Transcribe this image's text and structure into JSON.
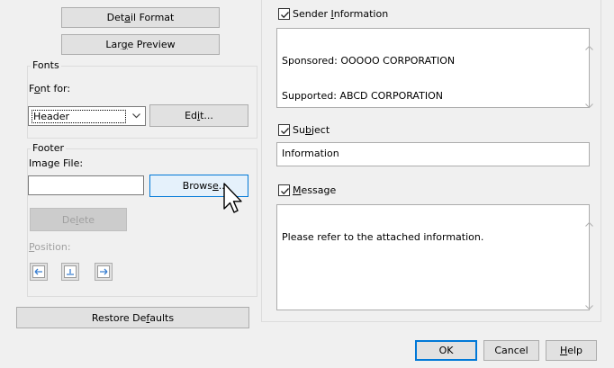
{
  "left": {
    "detail_format": "Detail Format",
    "large_preview": "Large Preview",
    "fonts": {
      "group_label": "Fonts",
      "font_for_label": "Font for:",
      "font_for_value": "Header",
      "edit_button": "Edit..."
    },
    "footer": {
      "group_label": "Footer",
      "image_file_label": "Image File:",
      "image_file_value": "",
      "browse_button": "Browse...",
      "delete_button": "Delete",
      "position_label": "Position:"
    },
    "restore_defaults": "Restore Defaults"
  },
  "right": {
    "sender": {
      "checked": true,
      "label": "Sender Information",
      "lines": [
        "Sponsored: OOOOO CORPORATION",
        "Supported: ABCD CORPORATION"
      ]
    },
    "subject": {
      "checked": true,
      "label": "Subject",
      "value": "Information"
    },
    "message": {
      "checked": true,
      "label": "Message",
      "text": "Please refer to the attached information."
    }
  },
  "dialog_buttons": {
    "ok": "OK",
    "cancel": "Cancel",
    "help": "Help"
  },
  "icons": {
    "position_left": "arrow-left-icon",
    "position_center": "align-center-icon",
    "position_right": "arrow-right-icon",
    "cursor": "mouse-pointer-icon"
  },
  "colors": {
    "background": "#f0f0f0",
    "accent": "#0078d7",
    "hover": "#e5f1fb",
    "disabled_text": "#a0a0a0"
  }
}
